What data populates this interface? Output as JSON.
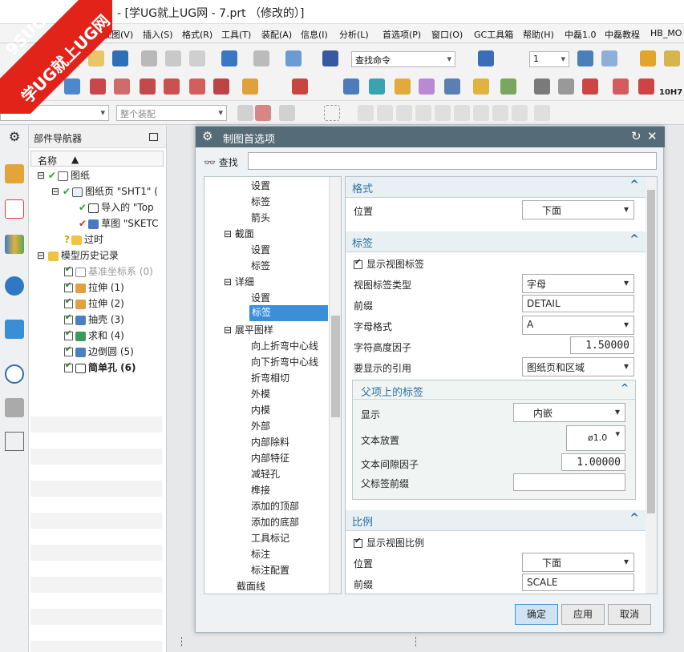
{
  "window": {
    "title": "- [学UG就上UG网 - 7.prt （修改的）]"
  },
  "watermark": {
    "line1": "9SUG",
    "line2": "学UG就上UG网"
  },
  "menu": [
    "视图(V)",
    "插入(S)",
    "格式(R)",
    "工具(T)",
    "装配(A)",
    "信息(I)",
    "分析(L)",
    "首选项(P)",
    "窗口(O)",
    "GC工具箱",
    "帮助(H)",
    "中磊1.0",
    "中磊教程",
    "HB_MO"
  ],
  "toolbar": {
    "find_command": "查找命令",
    "layer_value": "1",
    "assembly_placeholder": "整个装配",
    "sketch_label": "10H7"
  },
  "navigator": {
    "title": "部件导航器",
    "column": "名称",
    "items": [
      {
        "label": "图纸"
      },
      {
        "label": "图纸页 \"SHT1\" ("
      },
      {
        "label": "导入的 \"Top"
      },
      {
        "label": "草图 \"SKETC"
      },
      {
        "label": "过时"
      },
      {
        "label": "模型历史记录"
      },
      {
        "label": "基准坐标系 (0)"
      },
      {
        "label": "拉伸 (1)"
      },
      {
        "label": "拉伸 (2)"
      },
      {
        "label": "抽壳 (3)"
      },
      {
        "label": "求和 (4)"
      },
      {
        "label": "边倒圆 (5)"
      },
      {
        "label": "简单孔 (6)"
      }
    ]
  },
  "dialog": {
    "title": "制图首选项",
    "find_label": "查找",
    "tree": [
      "设置",
      "标签",
      "箭头",
      "截面",
      "设置",
      "标签",
      "详细",
      "设置",
      "标签",
      "展平图样",
      "向上折弯中心线",
      "向下折弯中心线",
      "折弯相切",
      "外模",
      "内模",
      "外部",
      "内部除料",
      "内部特征",
      "减轻孔",
      "榫接",
      "添加的顶部",
      "添加的底部",
      "工具标记",
      "标注",
      "标注配置",
      "截面线"
    ],
    "sections": {
      "format": {
        "title": "格式",
        "position_label": "位置",
        "position_value": "下面"
      },
      "label": {
        "title": "标签",
        "show_label": "显示视图标签",
        "type_label": "视图标签类型",
        "type_value": "字母",
        "prefix_label": "前缀",
        "prefix_value": "DETAIL",
        "letter_format_label": "字母格式",
        "letter_format_value": "A",
        "char_height_label": "字符高度因子",
        "char_height_value": "1.50000",
        "ref_label": "要显示的引用",
        "ref_value": "图纸页和区域",
        "parent": {
          "title": "父项上的标签",
          "display_label": "显示",
          "display_value": "内嵌",
          "placement_label": "文本放置",
          "placement_value": "ø1.0",
          "gap_label": "文本间隙因子",
          "gap_value": "1.00000",
          "prefix_label": "父标签前缀",
          "prefix_value": ""
        }
      },
      "scale": {
        "title": "比例",
        "show_scale": "显示视图比例",
        "position_label": "位置",
        "position_value": "下面",
        "prefix_label": "前缀",
        "prefix_value": "SCALE"
      }
    },
    "buttons": {
      "ok": "确定",
      "apply": "应用",
      "cancel": "取消"
    }
  }
}
